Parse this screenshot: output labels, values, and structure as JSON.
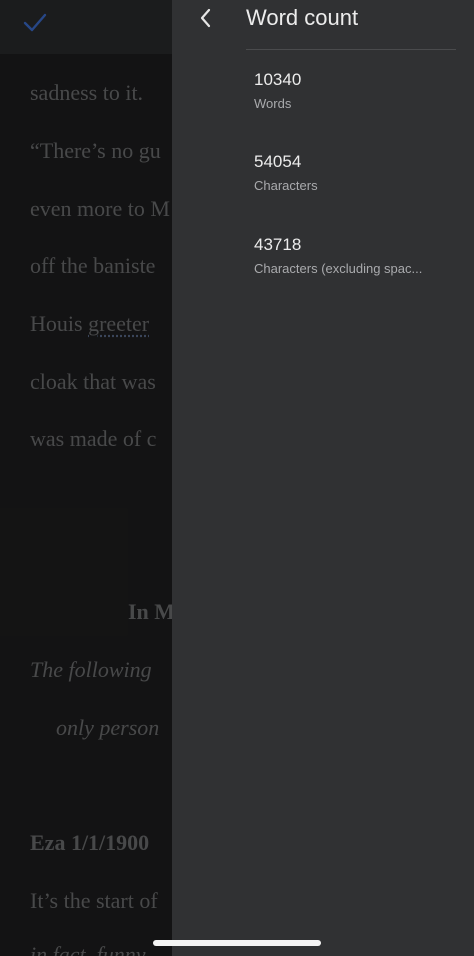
{
  "colors": {
    "panel_bg": "#303133",
    "doc_bg": "#1e1e1f",
    "accent_check": "#3d6ed0"
  },
  "toolbar": {
    "done_icon": "check-icon"
  },
  "document": {
    "lines": [
      "sadness to it.",
      "“There’s no gu",
      "even more to M",
      "off the baniste",
      "Houis ",
      "greeter",
      "cloak that was",
      "was made of c",
      "In M",
      "The following",
      "only person",
      "Eza 1/1/1900",
      "It’s the start of",
      "in fact, funny"
    ]
  },
  "word_count_panel": {
    "title": "Word count",
    "back_icon": "chevron-left-icon",
    "stats": [
      {
        "value": "10340",
        "label": "Words"
      },
      {
        "value": "54054",
        "label": "Characters"
      },
      {
        "value": "43718",
        "label": "Characters (excluding spac..."
      }
    ]
  }
}
